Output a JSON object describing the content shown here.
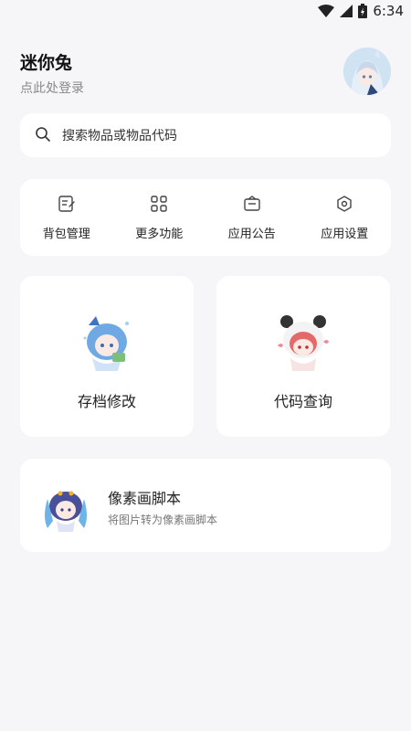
{
  "status_bar": {
    "time": "6:34"
  },
  "profile": {
    "name": "迷你兔",
    "login_hint": "点此处登录"
  },
  "search": {
    "placeholder": "搜索物品或物品代码"
  },
  "quick_actions": [
    {
      "label": "背包管理",
      "icon": "edit-document-icon"
    },
    {
      "label": "更多功能",
      "icon": "grid-icon"
    },
    {
      "label": "应用公告",
      "icon": "announcement-icon"
    },
    {
      "label": "应用设置",
      "icon": "settings-icon"
    }
  ],
  "features": {
    "save_edit": {
      "label": "存档修改"
    },
    "code_lookup": {
      "label": "代码查询"
    }
  },
  "pixel_script": {
    "title": "像素画脚本",
    "desc": "将图片转为像素画脚本"
  },
  "colors": {
    "background": "#f6f6f8",
    "card": "#ffffff",
    "text": "#222222",
    "muted": "#888888"
  }
}
